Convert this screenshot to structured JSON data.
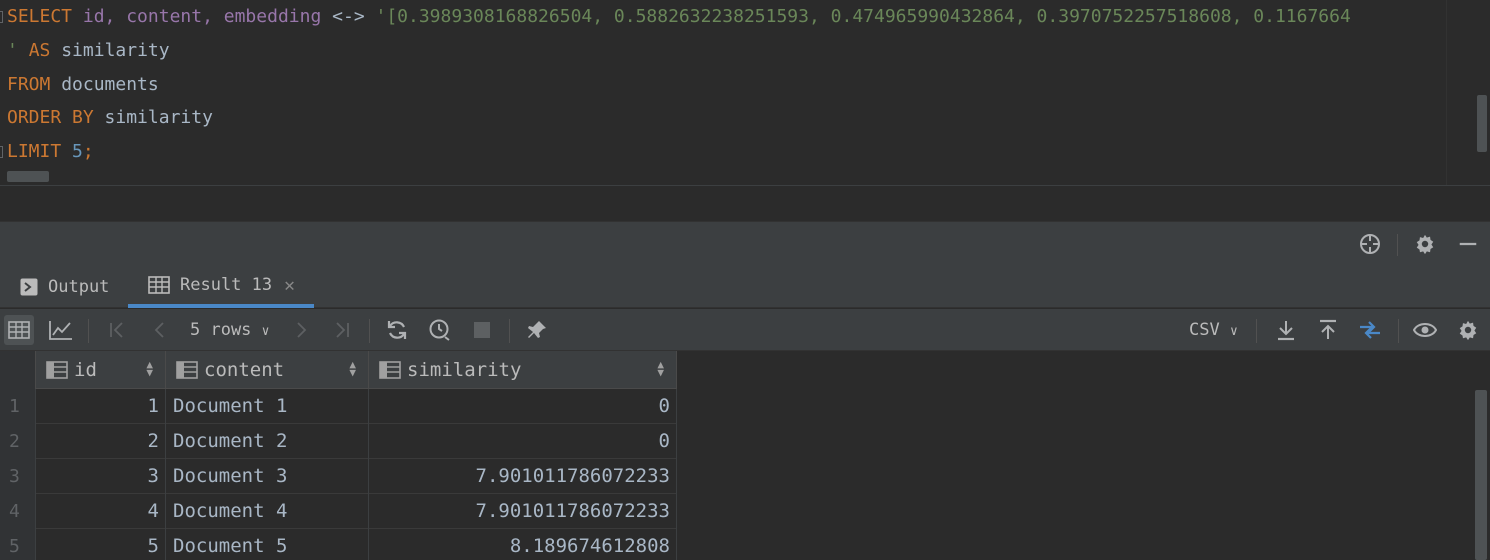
{
  "editor": {
    "line1": {
      "kw_select": "SELECT",
      "cols": "id, content, embedding",
      "op": "<->",
      "literal": "'[0.3989308168826504, 0.5882632238251593, 0.474965990432864, 0.3970752257518608, 0.1167664"
    },
    "line2": {
      "quote": "'",
      "kw_as": "AS",
      "alias": "similarity"
    },
    "line3": {
      "kw_from": "FROM",
      "table": "documents"
    },
    "line4": {
      "kw_order": "ORDER BY",
      "ident": "similarity"
    },
    "line5": {
      "kw_limit": "LIMIT",
      "num": "5",
      "semi": ";"
    }
  },
  "tool_window": {
    "tabs": [
      {
        "label": "Output",
        "icon": "console-icon"
      },
      {
        "label": "Result 13",
        "icon": "table-icon",
        "closable": true
      }
    ],
    "header_icons": [
      "crosshair-icon",
      "gear-icon",
      "minimize-icon"
    ]
  },
  "toolbar": {
    "rows_label": "5 rows",
    "export_format": "CSV"
  },
  "grid": {
    "columns": [
      "id",
      "content",
      "similarity"
    ],
    "rows": [
      {
        "n": "1",
        "id": "1",
        "content": "Document 1",
        "similarity": "0"
      },
      {
        "n": "2",
        "id": "2",
        "content": "Document 2",
        "similarity": "0"
      },
      {
        "n": "3",
        "id": "3",
        "content": "Document 3",
        "similarity": "7.901011786072233"
      },
      {
        "n": "4",
        "id": "4",
        "content": "Document 4",
        "similarity": "7.901011786072233"
      },
      {
        "n": "5",
        "id": "5",
        "content": "Document 5",
        "similarity": "8.189674612808"
      }
    ]
  },
  "colors": {
    "keyword": "#cc7832",
    "column": "#9876aa",
    "string": "#6a8759",
    "number": "#6897bb",
    "accent": "#4a88c7"
  }
}
